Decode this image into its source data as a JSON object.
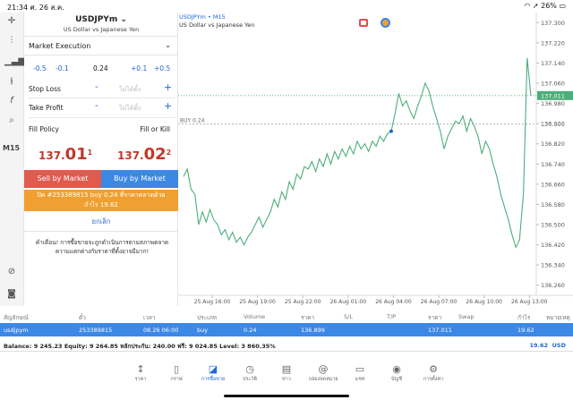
{
  "status": {
    "time": "21:34",
    "date": "ศ. 26 ส.ค.",
    "battery": "26%"
  },
  "sidebar": {
    "timeframe": "M15"
  },
  "trade": {
    "symbol": "USDJPYm",
    "description": "US Dollar vs Japanese Yen",
    "execution": "Market Execution",
    "volume": {
      "minus_large": "-0.5",
      "minus_small": "-0.1",
      "value": "0.24",
      "plus_small": "+0.1",
      "plus_large": "+0.5"
    },
    "stop_loss": {
      "label": "Stop Loss",
      "minus": "-",
      "placeholder": "ไม่ได้ตั้ง",
      "plus": "+"
    },
    "take_profit": {
      "label": "Take Profit",
      "minus": "-",
      "placeholder": "ไม่ได้ตั้ง",
      "plus": "+"
    },
    "fill_policy": {
      "label": "Fill Policy",
      "value": "Fill or Kill"
    },
    "bid": {
      "main": "137.",
      "big": "01",
      "small": "1"
    },
    "ask": {
      "main": "137.",
      "big": "02",
      "small": "2"
    },
    "sell_label": "Sell by Market",
    "buy_label": "Buy by Market",
    "close_line1": "ปิด #253389815 buy 0.24 ที่ราคาตลาดด้วย",
    "close_line2": "กำไร 19.62",
    "cancel_label": "ยกเลิก",
    "warning_line1": "คำเตือน! การซื้อขายจะถูกดำเนินการตามสภาพตลาด",
    "warning_line2": "ความแตกต่างกับราคาที่ตั้งอาจมีมาก!"
  },
  "chart_header": {
    "title": "USDJPYm",
    "timeframe": "M15",
    "description": "US Dollar vs Japanese Yen"
  },
  "chart_data": {
    "type": "line",
    "y_ticks": [
      "137.300",
      "137.220",
      "137.140",
      "137.060",
      "136.980",
      "136.900",
      "136.820",
      "136.740",
      "136.660",
      "136.580",
      "136.500",
      "136.420",
      "136.340",
      "136.260"
    ],
    "ylim": [
      136.22,
      137.34
    ],
    "x_labels": [
      "25 Aug 16:00",
      "25 Aug 19:00",
      "25 Aug 22:00",
      "26 Aug 01:00",
      "26 Aug 04:00",
      "26 Aug 07:00",
      "26 Aug 10:00",
      "26 Aug 13:00"
    ],
    "x_label_positions": [
      0,
      12,
      24,
      36,
      48,
      60,
      72,
      84
    ],
    "current_price": "137.011",
    "buy_line": {
      "label": "BUY 0.24",
      "price": "136.899"
    },
    "entry_marker_index": 55,
    "values": [
      136.69,
      136.72,
      136.64,
      136.62,
      136.5,
      136.55,
      136.51,
      136.56,
      136.52,
      136.5,
      136.46,
      136.48,
      136.44,
      136.47,
      136.43,
      136.45,
      136.42,
      136.45,
      136.47,
      136.5,
      136.53,
      136.49,
      136.52,
      136.55,
      136.6,
      136.57,
      136.63,
      136.6,
      136.67,
      136.64,
      136.7,
      136.68,
      136.73,
      136.72,
      136.75,
      136.71,
      136.76,
      136.73,
      136.78,
      136.74,
      136.79,
      136.76,
      136.8,
      136.77,
      136.81,
      136.78,
      136.83,
      136.8,
      136.82,
      136.79,
      136.83,
      136.81,
      136.85,
      136.83,
      136.86,
      136.87,
      136.94,
      137.02,
      136.97,
      136.99,
      136.95,
      136.92,
      136.97,
      137.01,
      137.06,
      137.03,
      136.97,
      136.92,
      136.87,
      136.8,
      136.85,
      136.88,
      136.91,
      136.9,
      136.93,
      136.87,
      136.92,
      136.89,
      136.85,
      136.78,
      136.83,
      136.8,
      136.74,
      136.69,
      136.62,
      136.57,
      136.52,
      136.46,
      136.41,
      136.44,
      136.62,
      137.16,
      137.01
    ]
  },
  "positions_table": {
    "headers": [
      "สัญลักษณ์",
      "ตั๋ว",
      "เวลา",
      "ประเภท",
      "Volume",
      "ราคา",
      "S/L",
      "T/P",
      "ราคา",
      "Swap",
      "กำไร",
      "หมายเหตุ"
    ],
    "row": [
      "usdjpym",
      "253389815",
      "08.26 06:00",
      "buy",
      "0.24",
      "136.899",
      "",
      "",
      "137.011",
      "",
      "19.62",
      ""
    ]
  },
  "balance": {
    "text": "Balance: 9 245.23 Equity: 9 264.85 หลักประกัน: 240.00 ฟรี: 9 024.85 Level: 3 860.35%",
    "profit": "19.62",
    "currency": "USD"
  },
  "tabs": [
    {
      "label": "ราคา",
      "icon": "↕"
    },
    {
      "label": "กราฟ",
      "icon": "▯"
    },
    {
      "label": "การซื้อขาย",
      "icon": "◪"
    },
    {
      "label": "ประวัติ",
      "icon": "◷"
    },
    {
      "label": "ข่าว",
      "icon": "▤"
    },
    {
      "label": "กล่องจดหมาย",
      "icon": "@"
    },
    {
      "label": "แชท",
      "icon": "▭"
    },
    {
      "label": "บัญชี",
      "icon": "◉"
    },
    {
      "label": "การตั้งค่า",
      "icon": "⚙"
    }
  ]
}
